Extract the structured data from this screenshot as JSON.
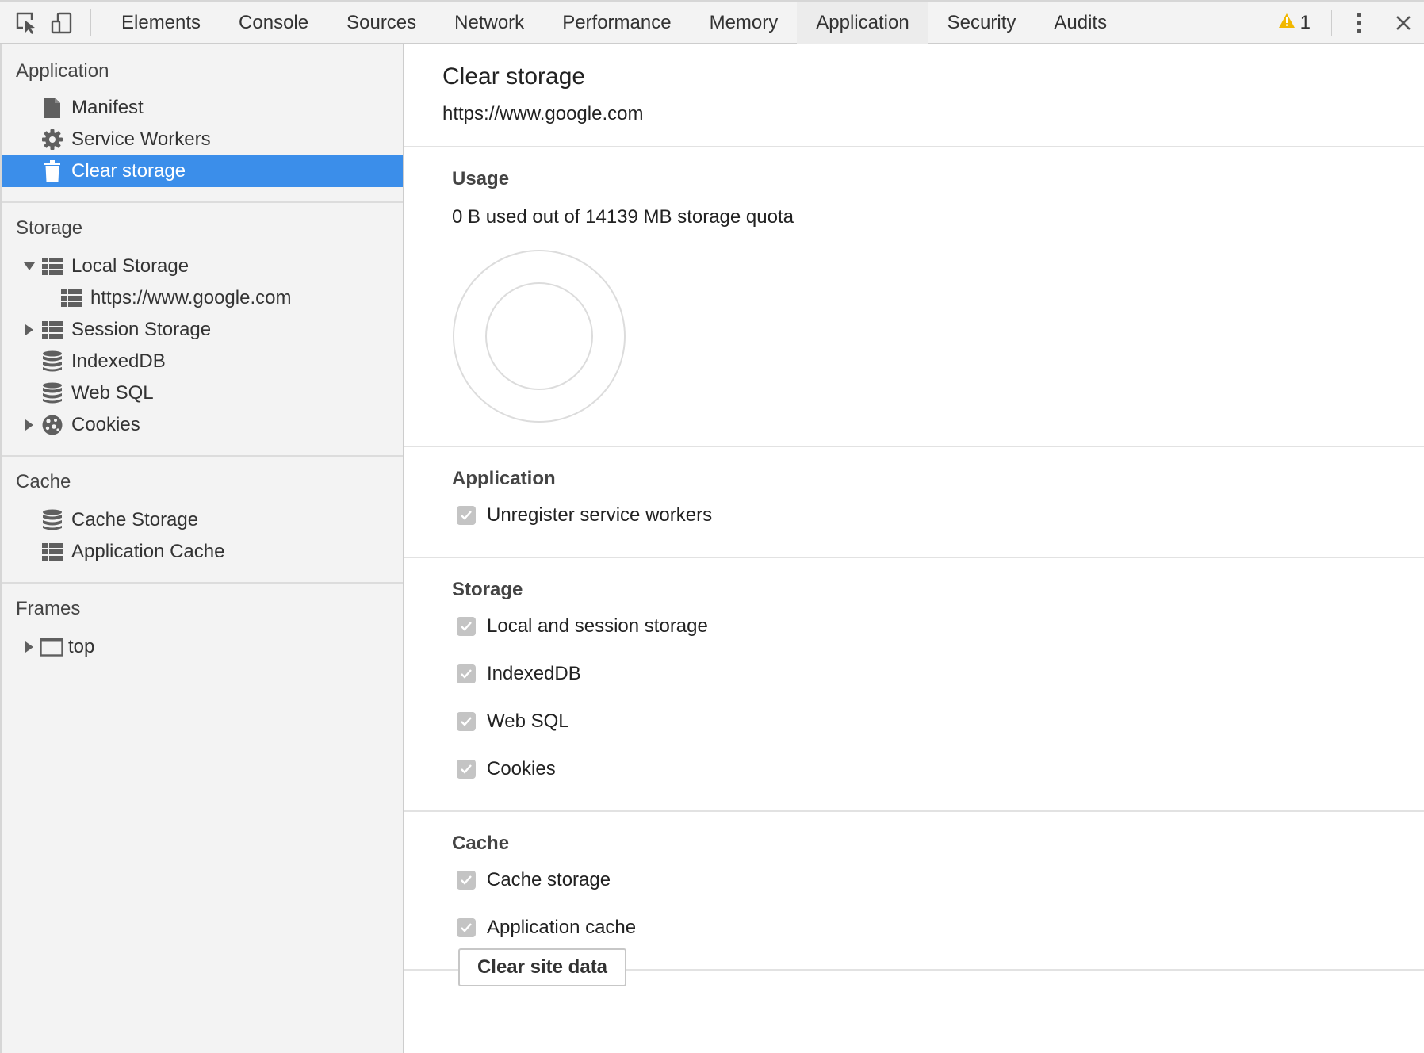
{
  "toolbar": {
    "tabs": [
      "Elements",
      "Console",
      "Sources",
      "Network",
      "Performance",
      "Memory",
      "Application",
      "Security",
      "Audits"
    ],
    "active_tab": "Application",
    "warning_count": "1",
    "accent_color": "#1a73e8",
    "warning_color": "#f1b700"
  },
  "sidebar": {
    "application": {
      "heading": "Application",
      "items": [
        "Manifest",
        "Service Workers",
        "Clear storage"
      ],
      "selected": "Clear storage"
    },
    "storage": {
      "heading": "Storage",
      "local_storage": "Local Storage",
      "local_origin": "https://www.google.com",
      "session_storage": "Session Storage",
      "indexeddb": "IndexedDB",
      "web_sql": "Web SQL",
      "cookies": "Cookies"
    },
    "cache": {
      "heading": "Cache",
      "cache_storage": "Cache Storage",
      "application_cache": "Application Cache"
    },
    "frames": {
      "heading": "Frames",
      "top": "top"
    },
    "selected_color": "#3b8eea"
  },
  "main": {
    "title": "Clear storage",
    "origin": "https://www.google.com",
    "usage": {
      "heading": "Usage",
      "text": "0 B used out of 14139 MB storage quota"
    },
    "application": {
      "heading": "Application",
      "options": [
        {
          "label": "Unregister service workers",
          "checked": true
        }
      ]
    },
    "storage": {
      "heading": "Storage",
      "options": [
        {
          "label": "Local and session storage",
          "checked": true
        },
        {
          "label": "IndexedDB",
          "checked": true
        },
        {
          "label": "Web SQL",
          "checked": true
        },
        {
          "label": "Cookies",
          "checked": true
        }
      ]
    },
    "cache": {
      "heading": "Cache",
      "options": [
        {
          "label": "Cache storage",
          "checked": true
        },
        {
          "label": "Application cache",
          "checked": true
        }
      ]
    },
    "clear_button": "Clear site data"
  }
}
